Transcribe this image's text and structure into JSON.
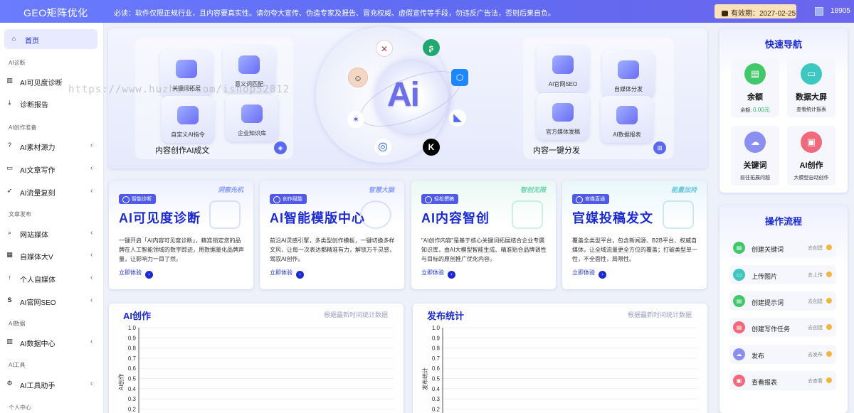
{
  "header": {
    "brand": "GEO矩阵优化",
    "notice": "必读：软件仅限正规行业，且内容要真实性。请勿夸大宣传、伪造专家及报告、冒充权威、虚假宣传等手段，勿违反广告法，否则后果自负。",
    "validity_label": "有效期：2027-02-25",
    "user_id": "18905"
  },
  "watermark": "https://www.huzhan.com/ishop52812",
  "sidebar": {
    "home": "首页",
    "sections": {
      "diag": "AI诊断",
      "prep": "AI创作准备",
      "publish": "文章发布",
      "data": "AI数据",
      "tools": "AI工具",
      "personal": "个人中心"
    },
    "items": {
      "visibility": "AI可见度诊断",
      "report": "诊断报告",
      "source": "AI素材源力",
      "writing": "AI文章写作",
      "replicate": "AI流量复刻",
      "website": "网站媒体",
      "wechat": "自媒体大V",
      "personal_media": "个人自媒体",
      "seo": "AI官网SEO",
      "data_center": "AI数据中心",
      "assistant": "AI工具助手"
    }
  },
  "hero": {
    "left_tiles": [
      "关键词拓展",
      "意义词匹配",
      "自定义AI指令",
      "企业知识库"
    ],
    "left_label": "内容创作AI成文",
    "right_tiles": [
      "AI官网SEO",
      "自媒体分发",
      "官方媒体发稿",
      "AI数据报表"
    ],
    "right_label": "内容一键分发",
    "center_text": "Ai",
    "logo_k": "K"
  },
  "cards": [
    {
      "badge": "智能诊断",
      "tag": "洞察先机",
      "title": "AI可见度诊断",
      "desc": "一键开启「AI内容可见度诊断」，精准锁定您的品牌在人工智能领域的数字踪迹，用数据量化品牌声量，让影响力一目了然。",
      "cta": "立即体验"
    },
    {
      "badge": "创作赋能",
      "tag": "智慧大脑",
      "title": "AI智能模版中心",
      "desc": "前沿AI灵感引擎，多类型创作模板，一键切换多样文风，让每一次表达都精准有力，解锁万千灵感，驾驭AI创作。",
      "cta": "立即体验"
    },
    {
      "badge": "轻松撰稿",
      "tag": "智创无限",
      "title": "AI内容智创",
      "desc": "\"AI创作内容\"是基于核心关键词拓展结合企业专属知识库，由AI大模型智能生成、精准贴合品牌调性与目标的原创推广优化内容。",
      "cta": "立即体验"
    },
    {
      "badge": "官媒直通",
      "tag": "能量加持",
      "title": "官媒投稿发文",
      "desc": "覆盖全类型平台，包含新闻源、B2B平台、权威自媒体，让全域流量更全方位的覆盖；打破类型单一性，不全面性，局限性。",
      "cta": "立即体验"
    }
  ],
  "charts": [
    {
      "title": "AI创作",
      "subtitle": "根据最新时间统计数据",
      "ylabel": "AI创作"
    },
    {
      "title": "发布统计",
      "subtitle": "根据最新时间统计数据",
      "ylabel": "发布统计"
    }
  ],
  "chart_data": [
    {
      "type": "line",
      "title": "AI创作",
      "ylabel": "AI创作",
      "xlabel": "",
      "ylim": [
        0,
        1.0
      ],
      "yticks": [
        "1.0",
        "0.9",
        "0.8",
        "0.7",
        "0.6",
        "0.5",
        "0.4",
        "0.3",
        "0.2"
      ],
      "series": []
    },
    {
      "type": "line",
      "title": "发布统计",
      "ylabel": "发布统计",
      "xlabel": "",
      "ylim": [
        0,
        1.0
      ],
      "yticks": [
        "1.0",
        "0.9",
        "0.8",
        "0.7",
        "0.6",
        "0.5",
        "0.4",
        "0.3",
        "0.2"
      ],
      "series": []
    }
  ],
  "quick_nav": {
    "title": "快速导航",
    "items": [
      {
        "label": "余额",
        "sub_prefix": "余额: ",
        "sub_value": "0.00元",
        "icon": "document-icon",
        "color": "#42c86b"
      },
      {
        "label": "数据大屏",
        "sub": "查看统计报表",
        "icon": "monitor-icon",
        "color": "#3ec7c0"
      },
      {
        "label": "关键词",
        "sub": "前往拓展问题",
        "icon": "cloud-icon",
        "color": "#8b8ff2"
      },
      {
        "label": "AI创作",
        "sub": "大模型自动创作",
        "icon": "box-icon",
        "color": "#f06a7c"
      }
    ]
  },
  "flow": {
    "title": "操作流程",
    "items": [
      {
        "label": "创建关键词",
        "status": "去创建",
        "color": "#42c86b"
      },
      {
        "label": "上传图片",
        "status": "去上传",
        "color": "#3ec7c0"
      },
      {
        "label": "创建提示词",
        "status": "去创建",
        "color": "#42c86b"
      },
      {
        "label": "创建写作任务",
        "status": "去创建",
        "color": "#f06a7c"
      },
      {
        "label": "发布",
        "status": "去发布",
        "color": "#8b8ff2"
      },
      {
        "label": "查看报表",
        "status": "去查看",
        "color": "#f06a7c"
      }
    ]
  }
}
